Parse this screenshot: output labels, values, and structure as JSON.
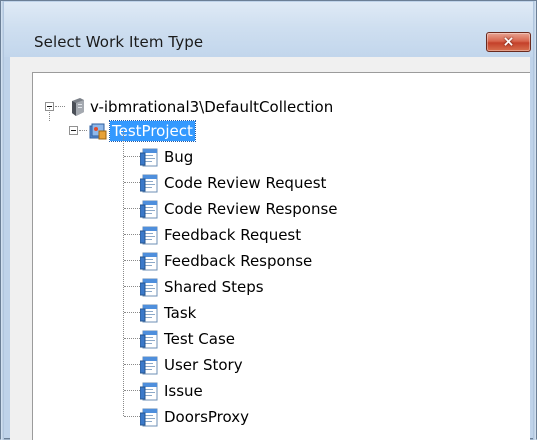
{
  "dialog": {
    "title": "Select Work Item Type",
    "close_glyph": "×"
  },
  "tree": {
    "root": {
      "label": "v-ibmrational3\\DefaultCollection",
      "icon": "server-icon",
      "expanded": true
    },
    "project": {
      "label": "TestProject",
      "icon": "team-project-icon",
      "selected": true,
      "expanded": true
    },
    "work_item_types": [
      "Bug",
      "Code Review Request",
      "Code Review Response",
      "Feedback Request",
      "Feedback Response",
      "Shared Steps",
      "Task",
      "Test Case",
      "User Story",
      "Issue",
      "DoorsProxy"
    ],
    "work_item_icon": "work-item-type-icon"
  },
  "colors": {
    "selection": "#3399ff",
    "close_button": "#c4412a"
  }
}
